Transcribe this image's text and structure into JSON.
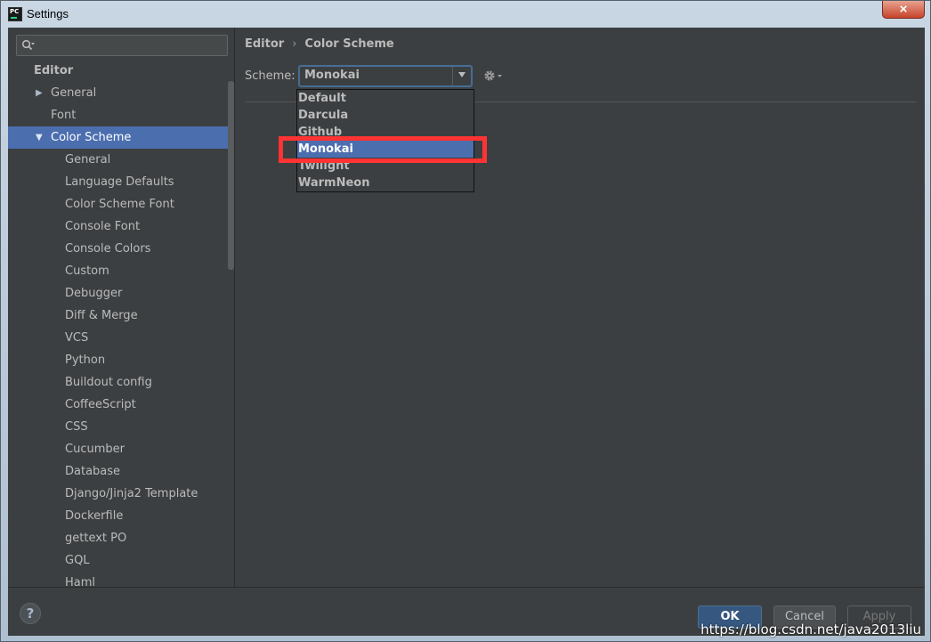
{
  "window": {
    "title": "Settings",
    "logo_text": "PC",
    "close_label": "×"
  },
  "search": {
    "placeholder": "",
    "value": ""
  },
  "tree": {
    "heading": "Editor",
    "items": [
      {
        "label": "General",
        "level": 1,
        "arrow": "▶"
      },
      {
        "label": "Font",
        "level": 1,
        "arrow": ""
      },
      {
        "label": "Color Scheme",
        "level": 1,
        "arrow": "▼",
        "selected": true
      },
      {
        "label": "General",
        "level": 2
      },
      {
        "label": "Language Defaults",
        "level": 2
      },
      {
        "label": "Color Scheme Font",
        "level": 2
      },
      {
        "label": "Console Font",
        "level": 2
      },
      {
        "label": "Console Colors",
        "level": 2
      },
      {
        "label": "Custom",
        "level": 2
      },
      {
        "label": "Debugger",
        "level": 2
      },
      {
        "label": "Diff & Merge",
        "level": 2
      },
      {
        "label": "VCS",
        "level": 2
      },
      {
        "label": "Python",
        "level": 2
      },
      {
        "label": "Buildout config",
        "level": 2
      },
      {
        "label": "CoffeeScript",
        "level": 2
      },
      {
        "label": "CSS",
        "level": 2
      },
      {
        "label": "Cucumber",
        "level": 2
      },
      {
        "label": "Database",
        "level": 2
      },
      {
        "label": "Django/Jinja2 Template",
        "level": 2
      },
      {
        "label": "Dockerfile",
        "level": 2
      },
      {
        "label": "gettext PO",
        "level": 2
      },
      {
        "label": "GQL",
        "level": 2
      },
      {
        "label": "Haml",
        "level": 2
      }
    ]
  },
  "breadcrumb": {
    "parent": "Editor",
    "separator": "›",
    "current": "Color Scheme"
  },
  "scheme": {
    "label": "Scheme:",
    "selected": "Monokai",
    "options": [
      "Default",
      "Darcula",
      "Github",
      "Monokai",
      "Twilight",
      "WarmNeon"
    ],
    "selected_index": 3
  },
  "footer": {
    "help_label": "?",
    "ok_label": "OK",
    "cancel_label": "Cancel",
    "apply_label": "Apply"
  },
  "watermark": "https://blog.csdn.net/java2013liu",
  "colors": {
    "selection": "#4b6eaf",
    "highlight": "#ff3333",
    "background": "#3c3f41",
    "ok_button": "#365880"
  }
}
